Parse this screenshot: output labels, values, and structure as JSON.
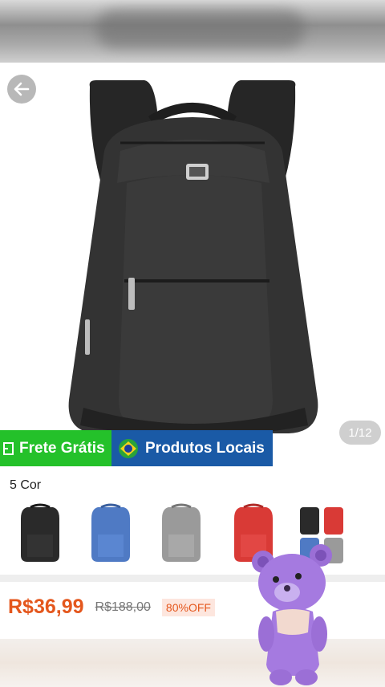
{
  "gallery": {
    "counter": "1/12"
  },
  "badges": {
    "frete": "Frete Grátis",
    "local": "Produtos Locais"
  },
  "variants": {
    "label": "5 Cor",
    "items": [
      {
        "color": "#2a2a2a"
      },
      {
        "color": "#4f7ac4"
      },
      {
        "color": "#9a9a9a"
      },
      {
        "color": "#d93a36"
      },
      {
        "color": "multi"
      }
    ]
  },
  "price": {
    "current": "R$36,99",
    "original": "R$188,00",
    "discount": "80%OFF"
  },
  "colors": {
    "accent": "#e4571d",
    "frete": "#24c12a",
    "local": "#1a5aa6"
  }
}
